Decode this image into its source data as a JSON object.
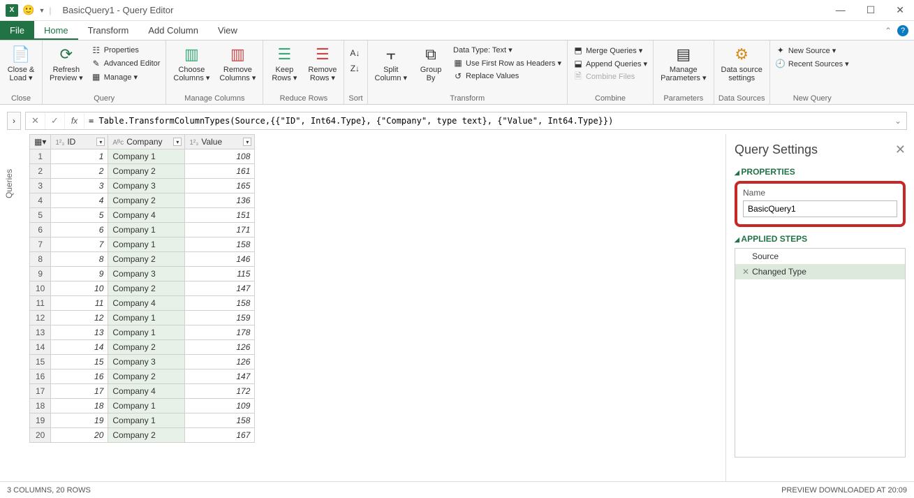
{
  "window": {
    "title": "BasicQuery1 - Query Editor"
  },
  "tabs": {
    "file": "File",
    "home": "Home",
    "transform": "Transform",
    "addcol": "Add Column",
    "view": "View"
  },
  "ribbon": {
    "close": {
      "label": "Close &\nLoad ▾",
      "group": "Close"
    },
    "query": {
      "refresh": "Refresh\nPreview ▾",
      "properties": "Properties",
      "advanced": "Advanced Editor",
      "manage": "Manage ▾",
      "group": "Query"
    },
    "managecols": {
      "choose": "Choose\nColumns ▾",
      "remove": "Remove\nColumns ▾",
      "group": "Manage Columns"
    },
    "reducerows": {
      "keep": "Keep\nRows ▾",
      "removerows": "Remove\nRows ▾",
      "group": "Reduce Rows"
    },
    "sort": {
      "group": "Sort"
    },
    "transform": {
      "split": "Split\nColumn ▾",
      "groupby": "Group\nBy",
      "datatype": "Data Type: Text ▾",
      "firstrow": "Use First Row as Headers ▾",
      "replace": "Replace Values",
      "group": "Transform"
    },
    "combine": {
      "merge": "Merge Queries ▾",
      "append": "Append Queries ▾",
      "combinefiles": "Combine Files",
      "group": "Combine"
    },
    "params": {
      "label": "Manage\nParameters ▾",
      "group": "Parameters"
    },
    "datasources": {
      "label": "Data source\nsettings",
      "group": "Data Sources"
    },
    "newquery": {
      "newsource": "New Source ▾",
      "recent": "Recent Sources ▾",
      "group": "New Query"
    }
  },
  "formula": "= Table.TransformColumnTypes(Source,{{\"ID\", Int64.Type}, {\"Company\", type text}, {\"Value\", Int64.Type}})",
  "queries_label": "Queries",
  "columns": {
    "id": "ID",
    "company": "Company",
    "value": "Value"
  },
  "rows": [
    {
      "n": 1,
      "id": 1,
      "company": "Company 1",
      "value": 108
    },
    {
      "n": 2,
      "id": 2,
      "company": "Company 2",
      "value": 161
    },
    {
      "n": 3,
      "id": 3,
      "company": "Company 3",
      "value": 165
    },
    {
      "n": 4,
      "id": 4,
      "company": "Company 2",
      "value": 136
    },
    {
      "n": 5,
      "id": 5,
      "company": "Company 4",
      "value": 151
    },
    {
      "n": 6,
      "id": 6,
      "company": "Company 1",
      "value": 171
    },
    {
      "n": 7,
      "id": 7,
      "company": "Company 1",
      "value": 158
    },
    {
      "n": 8,
      "id": 8,
      "company": "Company 2",
      "value": 146
    },
    {
      "n": 9,
      "id": 9,
      "company": "Company 3",
      "value": 115
    },
    {
      "n": 10,
      "id": 10,
      "company": "Company 2",
      "value": 147
    },
    {
      "n": 11,
      "id": 11,
      "company": "Company 4",
      "value": 158
    },
    {
      "n": 12,
      "id": 12,
      "company": "Company 1",
      "value": 159
    },
    {
      "n": 13,
      "id": 13,
      "company": "Company 1",
      "value": 178
    },
    {
      "n": 14,
      "id": 14,
      "company": "Company 2",
      "value": 126
    },
    {
      "n": 15,
      "id": 15,
      "company": "Company 3",
      "value": 126
    },
    {
      "n": 16,
      "id": 16,
      "company": "Company 2",
      "value": 147
    },
    {
      "n": 17,
      "id": 17,
      "company": "Company 4",
      "value": 172
    },
    {
      "n": 18,
      "id": 18,
      "company": "Company 1",
      "value": 109
    },
    {
      "n": 19,
      "id": 19,
      "company": "Company 1",
      "value": 158
    },
    {
      "n": 20,
      "id": 20,
      "company": "Company 2",
      "value": 167
    }
  ],
  "settings": {
    "title": "Query Settings",
    "properties": "PROPERTIES",
    "name_label": "Name",
    "name_value": "BasicQuery1",
    "steps_label": "APPLIED STEPS",
    "steps": [
      {
        "label": "Source",
        "sel": false,
        "del": false
      },
      {
        "label": "Changed Type",
        "sel": true,
        "del": true
      }
    ]
  },
  "status": {
    "left": "3 COLUMNS, 20 ROWS",
    "right": "PREVIEW DOWNLOADED AT 20:09"
  }
}
